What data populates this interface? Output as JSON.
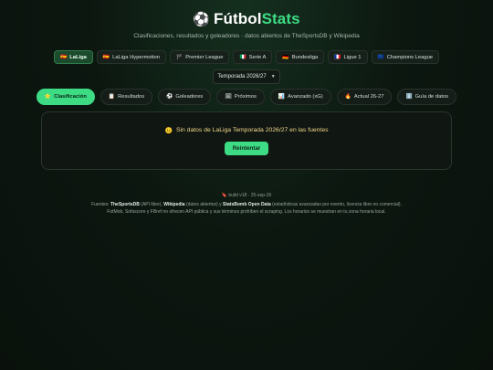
{
  "app": {
    "icon": "soccer-ball-icon",
    "title_main": "Fútbol",
    "title_accent": "Stats",
    "subtitle": "Clasificaciones, resultados y goleadores · datos abiertos de TheSportsDB y Wikipedia",
    "accent_color": "#3ddc84"
  },
  "leagues": [
    {
      "flag": "🇪🇸",
      "label": "LaLiga",
      "active": true
    },
    {
      "flag": "🇪🇸",
      "label": "LaLiga Hypermotion",
      "active": false
    },
    {
      "flag": "🏴",
      "label": "Premier League",
      "active": false
    },
    {
      "flag": "🇮🇹",
      "label": "Serie A",
      "active": false
    },
    {
      "flag": "🇩🇪",
      "label": "Bundesliga",
      "active": false
    },
    {
      "flag": "🇫🇷",
      "label": "Ligue 1",
      "active": false
    },
    {
      "flag": "🇪🇺",
      "label": "Champions League",
      "active": false
    }
  ],
  "season": {
    "selected": "Temporada 2026/27"
  },
  "tabs": [
    {
      "icon": "⭐",
      "label": "Clasificación",
      "active": true
    },
    {
      "icon": "📋",
      "label": "Resultados",
      "active": false
    },
    {
      "icon": "⚽",
      "label": "Goleadores",
      "active": false
    },
    {
      "icon": "🗓",
      "label": "Próximos",
      "active": false
    },
    {
      "icon": "📊",
      "label": "Avanzado (xG)",
      "active": false
    },
    {
      "icon": "🔥",
      "label": "Actual 26-27",
      "active": false
    },
    {
      "icon": "ℹ️",
      "label": "Guía de datos",
      "active": false
    }
  ],
  "panel": {
    "icon": "😐",
    "message": "Sin datos de LaLiga Temporada 2026/27 en las fuentes",
    "retry_label": "Reintentar"
  },
  "footer": {
    "build": "🔖 build v18 · 25-sep-26",
    "sources_prefix": "Fuentes: ",
    "source1": "TheSportsDB",
    "source1_note": " (API libre), ",
    "source2": "Wikipedia",
    "source2_note": " (datos abiertos) y ",
    "source3": "StatsBomb Open Data",
    "source3_note": " (estadísticas avanzadas por evento, licencia libre no comercial).",
    "note": "FotMob, Sofascore y FBref no ofrecen API pública y sus términos prohíben el scraping. Los horarios se muestran en tu zona horaria local."
  }
}
